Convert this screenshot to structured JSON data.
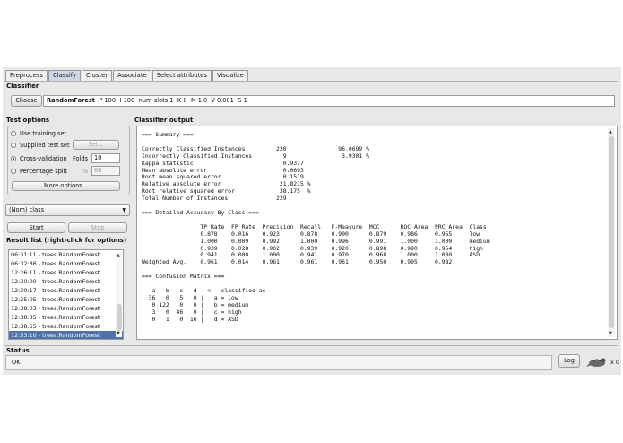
{
  "tabs": [
    "Preprocess",
    "Classify",
    "Cluster",
    "Associate",
    "Select attributes",
    "Visualize"
  ],
  "active_tab": "Classify",
  "classifier": {
    "section_title": "Classifier",
    "choose_label": "Choose",
    "name": "RandomForest",
    "options": "-P 100 -I 100 -num-slots 1 -K 0 -M 1.0 -V 0.001 -S 1"
  },
  "test_options": {
    "section_title": "Test options",
    "use_training_set": "Use training set",
    "supplied_test_set": "Supplied test set",
    "set_label": "Set...",
    "cross_validation": "Cross-validation",
    "folds_label": "Folds",
    "folds_value": "10",
    "percentage_split": "Percentage split",
    "percent_symbol": "%",
    "percent_value": "66",
    "more_options_label": "More options..."
  },
  "class_select": "(Nom) class",
  "start_label": "Start",
  "stop_label": "Stop",
  "result_list": {
    "section_title": "Result list (right-click for options)",
    "items": [
      "06:31:11 - trees.RandomForest",
      "06:32:36 - trees.RandomForest",
      "12:26:11 - trees.RandomForest",
      "12:30:00 - trees.RandomForest",
      "12:30:17 - trees.RandomForest",
      "12:35:05 - trees.RandomForest",
      "12:38:03 - trees.RandomForest",
      "12:38:35 - trees.RandomForest",
      "12:38:55 - trees.RandomForest",
      "12:53:10 - trees.RandomForest"
    ],
    "selected_index": 9
  },
  "output": {
    "section_title": "Classifier output",
    "lines": [
      "=== Summary ===",
      "",
      "Correctly Classified Instances         220               96.0699 %",
      "Incorrectly Classified Instances         9                3.9301 %",
      "Kappa statistic                          0.9377",
      "Mean absolute error                      0.0693",
      "Root mean squared error                  0.1519",
      "Relative absolute error                 21.8215 %",
      "Root relative squared error             38.175  %",
      "Total Number of Instances              229",
      "",
      "=== Detailed Accuracy By Class ===",
      "",
      "                 TP Rate  FP Rate  Precision  Recall   F-Measure  MCC      ROC Area  PRC Area  Class",
      "                 0.878    0.016    0.923      0.878    0.900      0.879    0.986     0.955     low",
      "                 1.000    0.009    0.992      1.000    0.996      0.991    1.000     1.000     medium",
      "                 0.939    0.028    0.902      0.939    0.920      0.898    0.990     0.954     high",
      "                 0.941    0.000    1.000      0.941    0.970      0.968    1.000     1.000     ASD",
      "Weighted Avg.    0.961    0.014    0.961      0.961    0.961      0.950    0.995     0.982",
      "",
      "=== Confusion Matrix ===",
      "",
      "   a   b   c   d   <-- classified as",
      "  36   0   5   0 |   a = low",
      "   0 122   0   0 |   b = medium",
      "   3   0  46   0 |   c = high",
      "   0   1   0  16 |   d = ASD"
    ]
  },
  "status": {
    "section_title": "Status",
    "text": "OK",
    "log_label": "Log",
    "count": "x 0"
  }
}
